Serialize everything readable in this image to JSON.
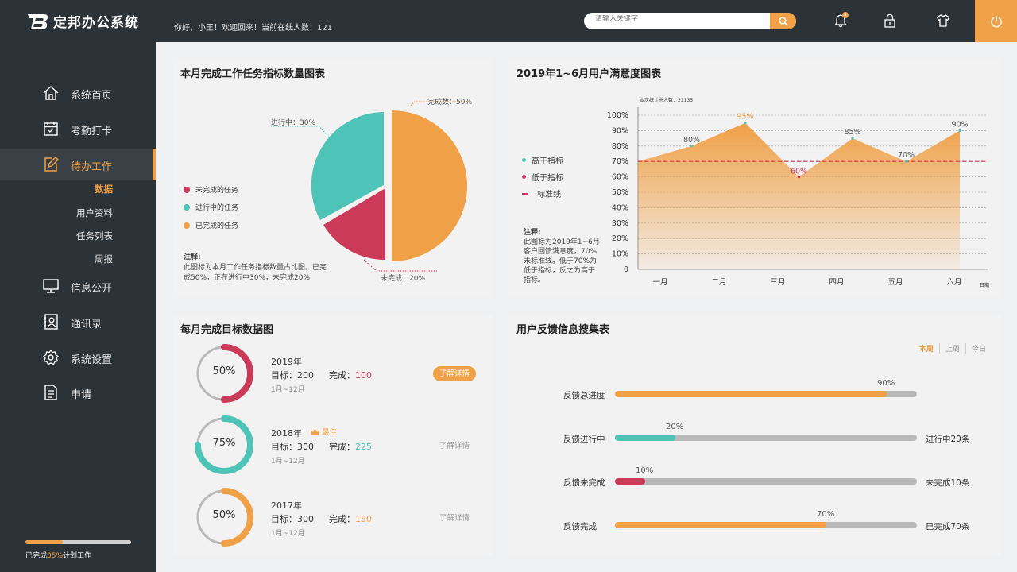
{
  "app": {
    "title": "定邦办公系统",
    "greeting": "你好，小王！欢迎回来！当前在线人数：121"
  },
  "header": {
    "search_placeholder": "请输入关键字",
    "notify_count": "1",
    "icons": [
      "search-icon",
      "bell-icon",
      "lock-icon",
      "shirt-icon",
      "power-icon"
    ]
  },
  "sidebar": {
    "items": [
      {
        "label": "系统首页",
        "icon": "home-icon"
      },
      {
        "label": "考勤打卡",
        "icon": "calendar-icon"
      },
      {
        "label": "待办工作",
        "icon": "edit-icon"
      },
      {
        "label": "信息公开",
        "icon": "monitor-icon"
      },
      {
        "label": "通讯录",
        "icon": "contacts-icon"
      },
      {
        "label": "系统设置",
        "icon": "gear-icon"
      },
      {
        "label": "申请",
        "icon": "document-icon"
      }
    ],
    "sub_items": [
      "数据",
      "用户资料",
      "任务列表",
      "周报"
    ],
    "plan": {
      "prefix": "已完成",
      "value": "35%",
      "suffix": "计划工作",
      "fraction": 0.35
    }
  },
  "colors": {
    "orange": "#f0a046",
    "teal": "#4ec3b8",
    "red": "#cc3a5a",
    "dark": "#2c3338"
  },
  "pie_panel": {
    "title": "本月完成工作任务指标数量图表",
    "callouts": {
      "done": "完成数：50%",
      "progress": "进行中：30%",
      "undone": "未完成：20%"
    },
    "legend": [
      "未完成的任务",
      "进行中的任务",
      "已完成的任务"
    ],
    "note_title": "注释:",
    "note_body": "此图标为本月工作任务指标数量占比图，已完成50%，正在进行中30%，未完成20%"
  },
  "line_panel": {
    "title": "2019年1~6月用户满意度图表",
    "chart_caption": "本次统计总人数：21135",
    "legend": [
      "高于指标",
      "低于指标",
      "标准线"
    ],
    "note_title": "注释:",
    "note_body": "此图标为2019年1~6月客户回馈满意度，70%未标准线。低于70%为低于指标，反之为高于指标。",
    "xunit": "日期"
  },
  "chart_data": [
    {
      "type": "pie",
      "title": "本月完成工作任务指标数量图表",
      "categories": [
        "已完成的任务",
        "进行中的任务",
        "未完成的任务"
      ],
      "values": [
        50,
        30,
        20
      ]
    },
    {
      "type": "area",
      "title": "2019年1~6月用户满意度图表",
      "categories": [
        "一月",
        "二月",
        "三月",
        "四月",
        "五月",
        "六月"
      ],
      "values": [
        70,
        80,
        95,
        60,
        85,
        70,
        90
      ],
      "point_labels": [
        "",
        "80%",
        "95%",
        "60%",
        "85%",
        "70%",
        "90%"
      ],
      "yticks": [
        "0",
        "10%",
        "20%",
        "30%",
        "40%",
        "50%",
        "60%",
        "70%",
        "80%",
        "90%",
        "100%"
      ],
      "ylim": [
        0,
        100
      ],
      "threshold": 70,
      "grid": true
    }
  ],
  "goals_panel": {
    "title": "每月完成目标数据图",
    "target_label": "目标：",
    "done_label": "完成：",
    "detail": "了解详情",
    "best": "最佳",
    "items": [
      {
        "pct": "50%",
        "fraction": 0.5,
        "year": "2019年",
        "target": "200",
        "done": "100",
        "range": "1月~12月",
        "color": "#cc3a5a"
      },
      {
        "pct": "75%",
        "fraction": 0.75,
        "year": "2018年",
        "target": "300",
        "done": "225",
        "range": "1月~12月",
        "color": "#4ec3b8"
      },
      {
        "pct": "50%",
        "fraction": 0.5,
        "year": "2017年",
        "target": "300",
        "done": "150",
        "range": "1月~12月",
        "color": "#f0a046"
      }
    ]
  },
  "feedback_panel": {
    "title": "用户反馈信息搜集表",
    "tabs": [
      "本周",
      "上周",
      "今日"
    ],
    "rows": [
      {
        "label": "反馈总进度",
        "pct": "90%",
        "fraction": 0.9,
        "right": "",
        "color": "#f0a046"
      },
      {
        "label": "反馈进行中",
        "pct": "20%",
        "fraction": 0.2,
        "right": "进行中20条",
        "color": "#4ec3b8"
      },
      {
        "label": "反馈未完成",
        "pct": "10%",
        "fraction": 0.1,
        "right": "未完成10条",
        "color": "#cc3a5a"
      },
      {
        "label": "反馈完成",
        "pct": "70%",
        "fraction": 0.7,
        "right": "已完成70条",
        "color": "#f0a046"
      }
    ]
  }
}
